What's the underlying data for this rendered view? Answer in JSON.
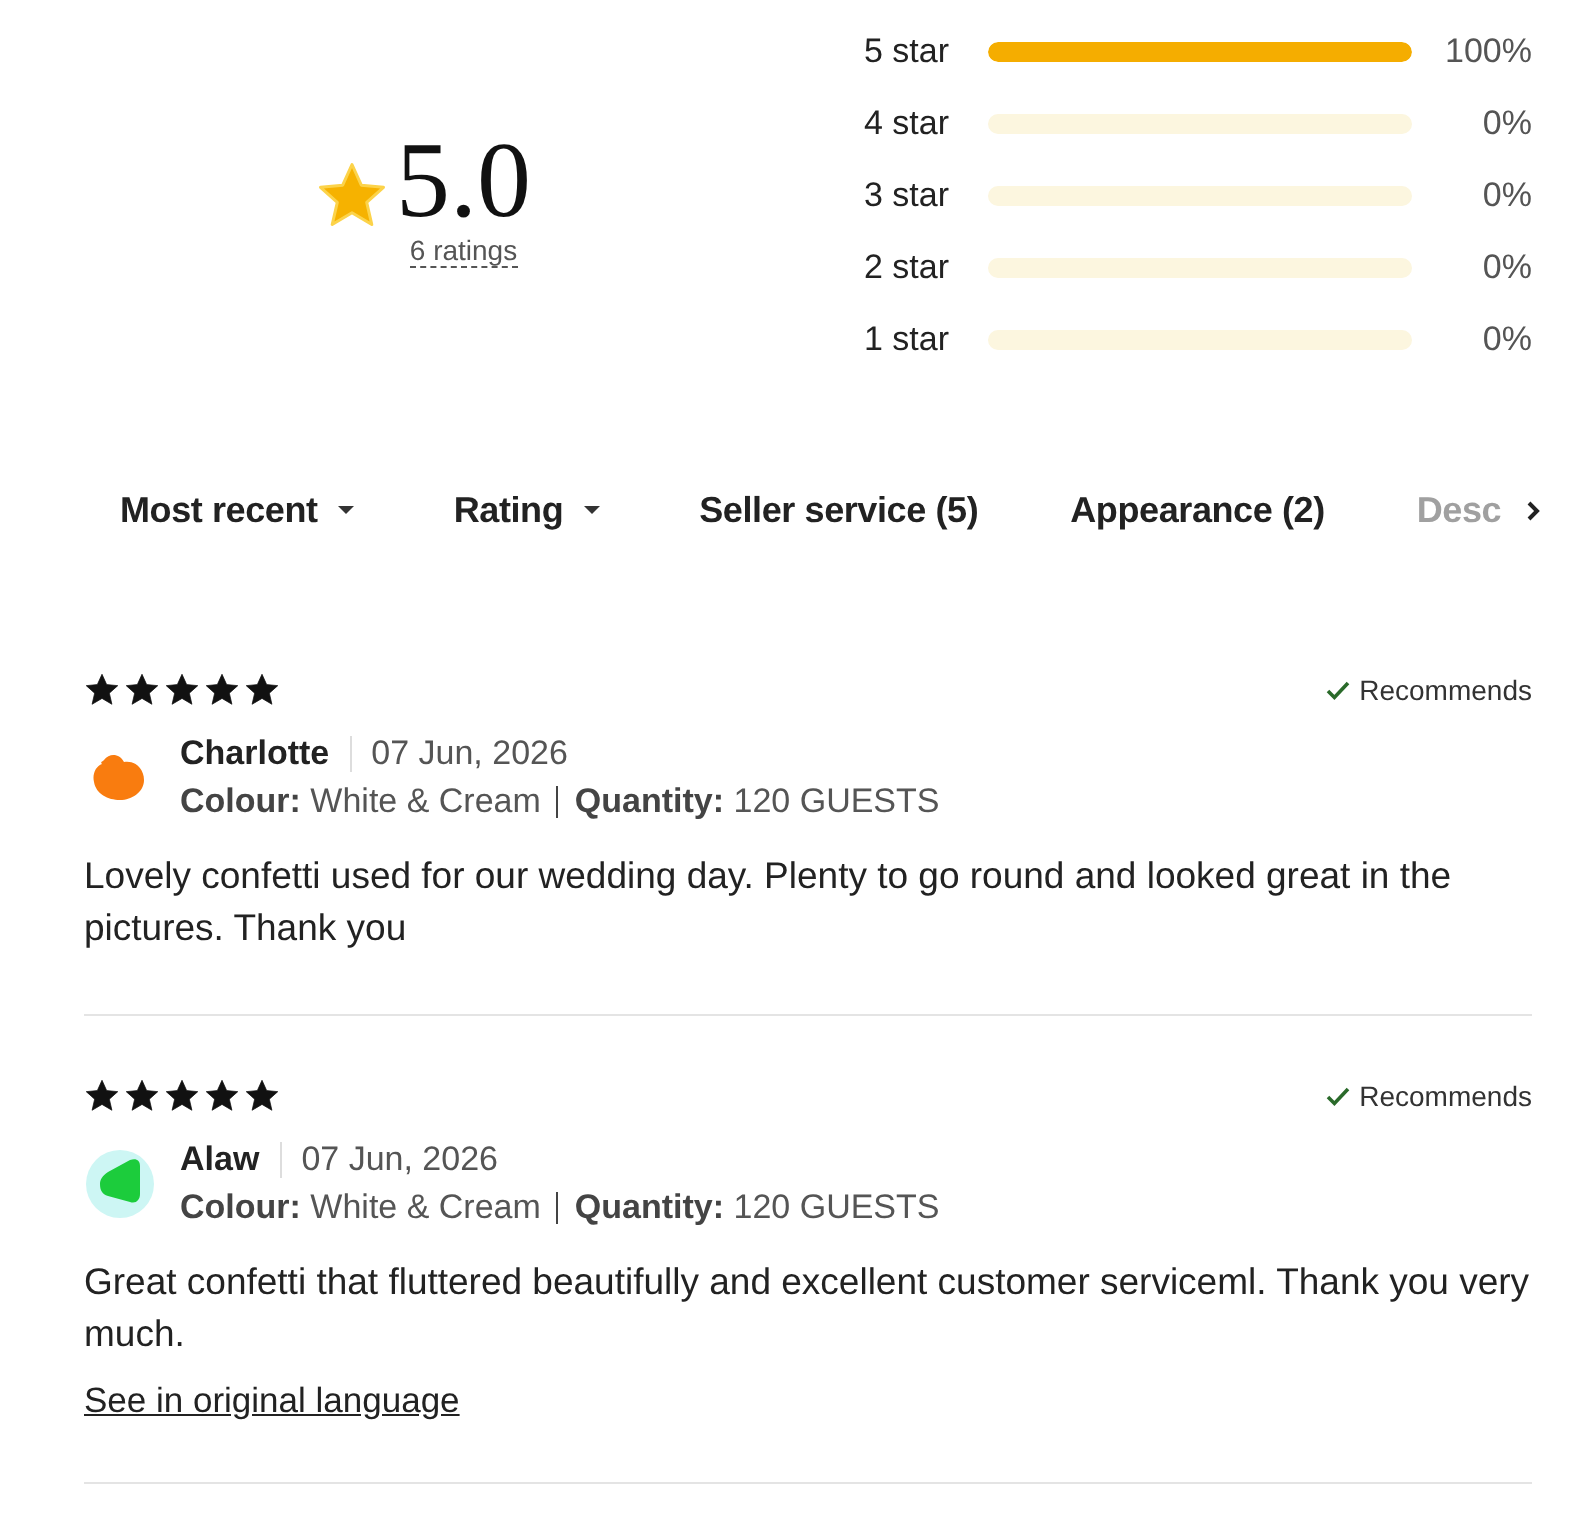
{
  "summary": {
    "average": "5.0",
    "ratings_link": "6 ratings"
  },
  "breakdown": [
    {
      "label": "5 star",
      "level": 1,
      "reading": "100%"
    },
    {
      "label": "4 star",
      "level": 0,
      "reading": "0%"
    },
    {
      "label": "3 star",
      "level": 0,
      "reading": "0%"
    },
    {
      "label": "2 star",
      "level": 0,
      "reading": "0%"
    },
    {
      "label": "1 star",
      "level": 0,
      "reading": "0%"
    }
  ],
  "filters": [
    {
      "label": "Most recent",
      "kind": "dropdown",
      "faded": false
    },
    {
      "label": "Rating",
      "kind": "dropdown",
      "faded": false
    },
    {
      "label": "Seller service (5)",
      "kind": "chip",
      "faded": false
    },
    {
      "label": "Appearance (2)",
      "kind": "chip",
      "faded": false
    },
    {
      "label": "Desc",
      "kind": "chip",
      "faded": true
    }
  ],
  "reviews": [
    {
      "stars": 5,
      "recommendation": "Recommends",
      "avatar": {
        "kind": "blob",
        "color": "#f97c0f"
      },
      "name": "Charlotte",
      "date": "07 Jun, 2026",
      "details": [
        "**Colour:** White & Cream",
        "**Quantity:** 120 GUESTS"
      ],
      "text": "Lovely confetti used for our wedding day. Plenty to go round and looked great in the pictures. Thank you"
    },
    {
      "stars": 5,
      "recommendation": "Recommends",
      "avatar": {
        "kind": "leaf",
        "color": "#1ccc3c"
      },
      "name": "Alaw",
      "date": "07 Jun, 2026",
      "details": [
        "**Colour:** White & Cream",
        "**Quantity:** 120 GUESTS"
      ],
      "text": "Great confetti that fluttered beautifully and excellent customer serviceml. Thank you very much.",
      "link": "See in original language"
    }
  ]
}
